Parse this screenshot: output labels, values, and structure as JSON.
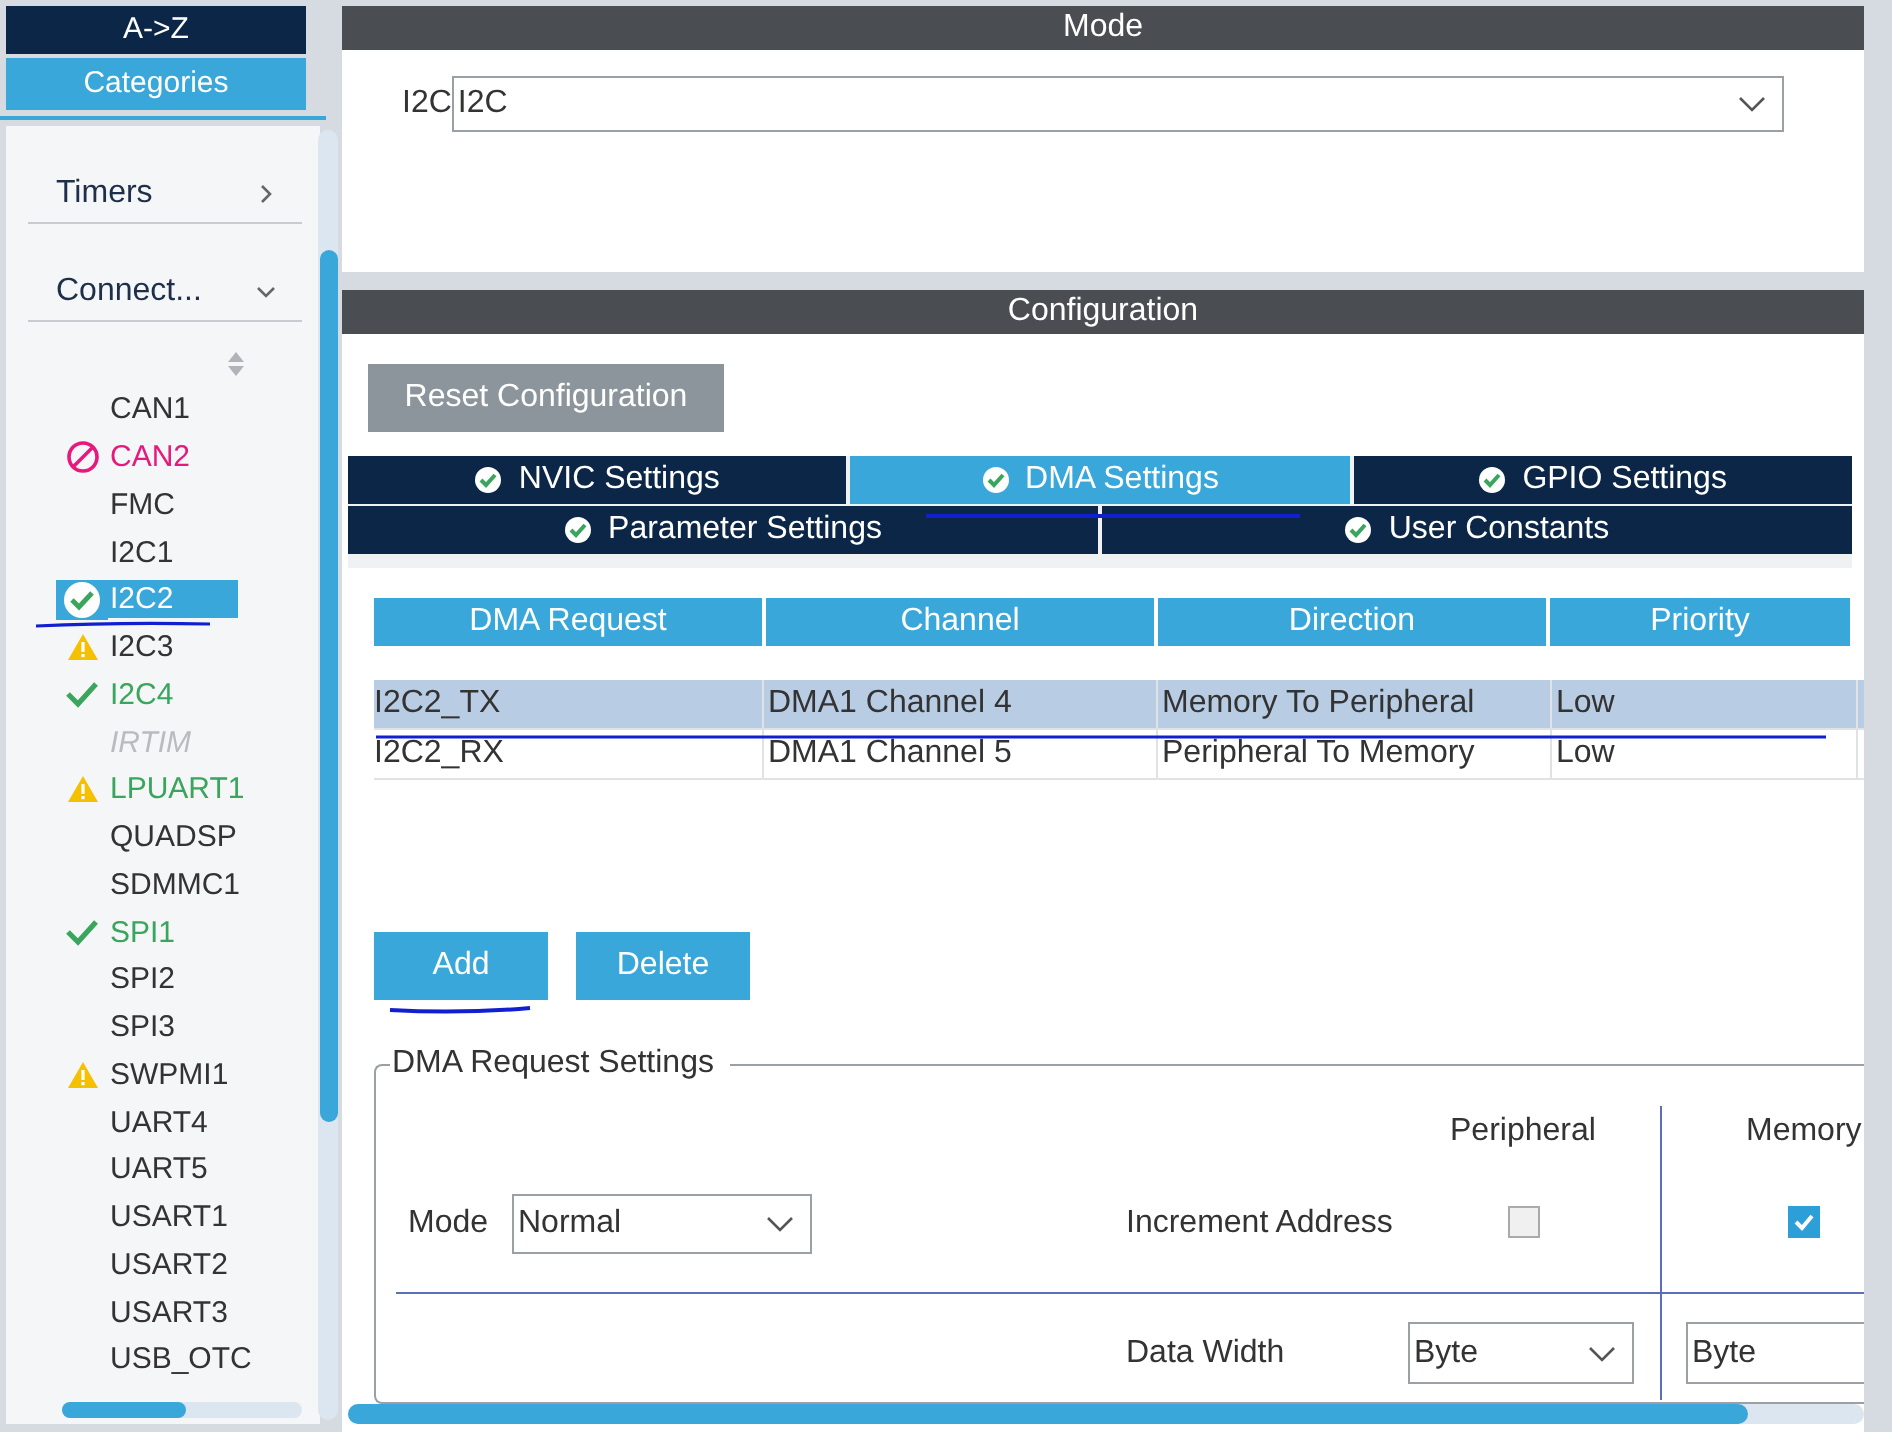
{
  "sidebar": {
    "sort_tabs": [
      {
        "label": "A->Z",
        "selected": false
      },
      {
        "label": "Categories",
        "selected": true
      }
    ],
    "groups": [
      {
        "label": "Timers",
        "expanded": false
      },
      {
        "label": "Connect...",
        "expanded": true
      }
    ],
    "items": [
      {
        "label": "CAN1",
        "kind": "none",
        "configured": false,
        "available": true,
        "selected": false
      },
      {
        "label": "CAN2",
        "kind": "blocked",
        "configured": false,
        "available": true,
        "selected": false
      },
      {
        "label": "FMC",
        "kind": "none",
        "configured": false,
        "available": true,
        "selected": false
      },
      {
        "label": "I2C1",
        "kind": "none",
        "configured": false,
        "available": true,
        "selected": false
      },
      {
        "label": "I2C2",
        "kind": "ok",
        "configured": false,
        "available": true,
        "selected": true
      },
      {
        "label": "I2C3",
        "kind": "warning",
        "configured": false,
        "available": true,
        "selected": false
      },
      {
        "label": "I2C4",
        "kind": "ok",
        "configured": true,
        "available": true,
        "selected": false
      },
      {
        "label": "IRTIM",
        "kind": "none",
        "configured": false,
        "available": false,
        "selected": false
      },
      {
        "label": "LPUART1",
        "kind": "warning",
        "configured": true,
        "available": true,
        "selected": false
      },
      {
        "label": "QUADSP",
        "kind": "none",
        "configured": false,
        "available": true,
        "selected": false
      },
      {
        "label": "SDMMC1",
        "kind": "none",
        "configured": false,
        "available": true,
        "selected": false
      },
      {
        "label": "SPI1",
        "kind": "ok",
        "configured": true,
        "available": true,
        "selected": false
      },
      {
        "label": "SPI2",
        "kind": "none",
        "configured": false,
        "available": true,
        "selected": false
      },
      {
        "label": "SPI3",
        "kind": "none",
        "configured": false,
        "available": true,
        "selected": false
      },
      {
        "label": "SWPMI1",
        "kind": "warning",
        "configured": false,
        "available": true,
        "selected": false
      },
      {
        "label": "UART4",
        "kind": "none",
        "configured": false,
        "available": true,
        "selected": false
      },
      {
        "label": "UART5",
        "kind": "none",
        "configured": false,
        "available": true,
        "selected": false
      },
      {
        "label": "USART1",
        "kind": "none",
        "configured": false,
        "available": true,
        "selected": false
      },
      {
        "label": "USART2",
        "kind": "none",
        "configured": false,
        "available": true,
        "selected": false
      },
      {
        "label": "USART3",
        "kind": "none",
        "configured": false,
        "available": true,
        "selected": false
      },
      {
        "label": "USB_OTC",
        "kind": "none",
        "configured": false,
        "available": true,
        "selected": false
      }
    ]
  },
  "mode": {
    "title": "Mode",
    "label": "I2C",
    "value": "I2C"
  },
  "configuration": {
    "title": "Configuration",
    "reset_button": "Reset Configuration",
    "tabs": [
      [
        {
          "label": "NVIC Settings",
          "selected": false
        },
        {
          "label": "DMA Settings",
          "selected": true
        },
        {
          "label": "GPIO Settings",
          "selected": false
        }
      ],
      [
        {
          "label": "Parameter Settings",
          "selected": false
        },
        {
          "label": "User Constants",
          "selected": false
        }
      ]
    ],
    "table": {
      "columns": [
        "DMA Request",
        "Channel",
        "Direction",
        "Priority"
      ],
      "rows": [
        {
          "cells": [
            "I2C2_TX",
            "DMA1 Channel 4",
            "Memory To Peripheral",
            "Low"
          ],
          "selected": true
        },
        {
          "cells": [
            "I2C2_RX",
            "DMA1 Channel 5",
            "Peripheral To Memory",
            "Low"
          ],
          "selected": false
        }
      ]
    },
    "buttons": [
      "Add",
      "Delete"
    ],
    "request_settings": {
      "title": "DMA Request Settings",
      "mode_label": "Mode",
      "mode_value": "Normal",
      "peripheral_header": "Peripheral",
      "memory_header": "Memory",
      "increment_label": "Increment Address",
      "peripheral_increment": false,
      "memory_increment": true,
      "data_width_label": "Data Width",
      "peripheral_width": "Byte",
      "memory_width": "Byte"
    }
  }
}
